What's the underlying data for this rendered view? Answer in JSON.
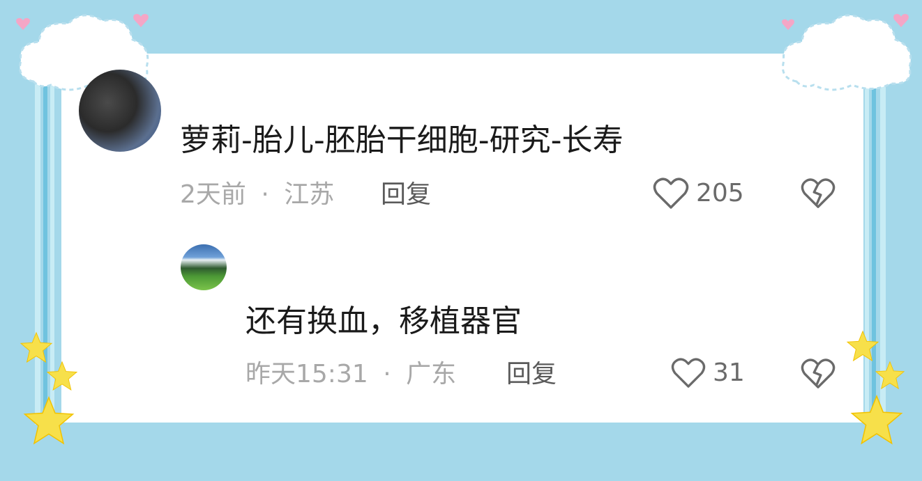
{
  "comments": [
    {
      "text": "萝莉-胎儿-胚胎干细胞-研究-长寿",
      "time": "2天前",
      "separator": "·",
      "location": "江苏",
      "reply_label": "回复",
      "likes": "205"
    },
    {
      "text": "还有换血，移植器官",
      "time": "昨天15:31",
      "separator": "·",
      "location": "广东",
      "reply_label": "回复",
      "likes": "31"
    }
  ],
  "icons": {
    "like": "heart-outline-icon",
    "dislike": "broken-heart-icon"
  },
  "colors": {
    "frame_background": "#a4d8ea",
    "card_background": "#ffffff",
    "meta_text": "#a8a8a8",
    "icon": "#6a6a6a",
    "star": "#f7e04a",
    "heart_decoration": "#f4a6c6"
  }
}
